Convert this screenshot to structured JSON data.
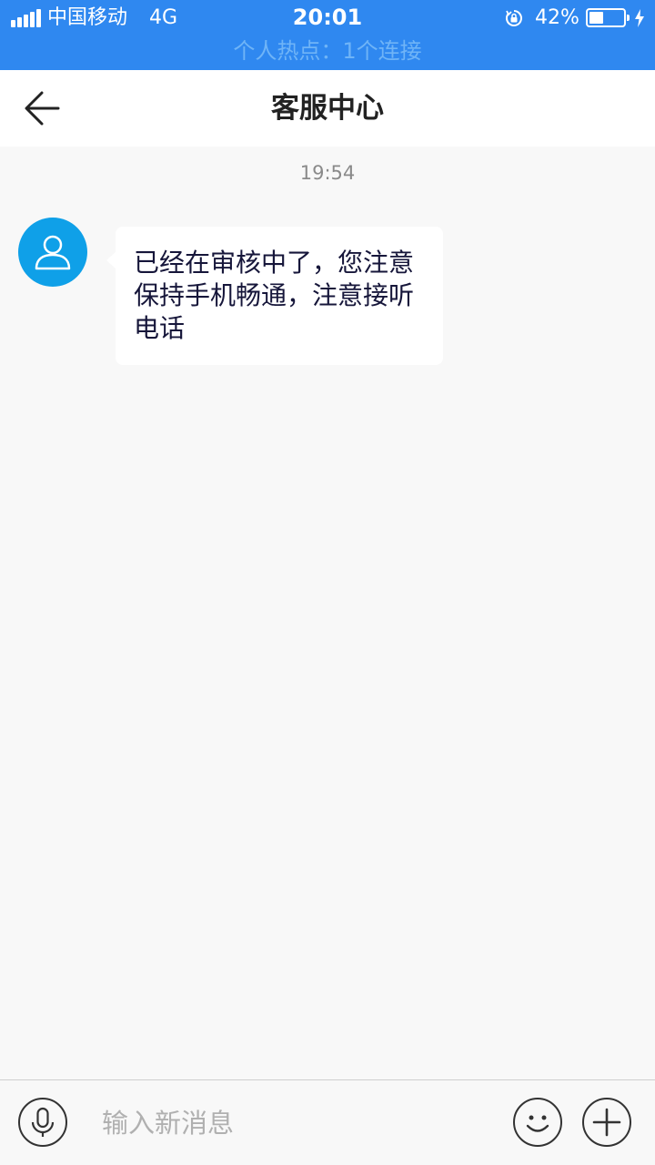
{
  "status_bar": {
    "carrier": "中国移动",
    "network": "4G",
    "time": "20:01",
    "battery_percent": "42%",
    "battery_level": 0.42,
    "hotspot": "个人热点：1个连接",
    "icons": [
      "signal-icon",
      "rotation-lock-icon",
      "battery-icon",
      "charging-bolt-icon"
    ],
    "background_color": "#2f88f0"
  },
  "header": {
    "title": "客服中心",
    "back_icon": "back-arrow-icon"
  },
  "chat": {
    "messages": [
      {
        "timestamp": "19:54",
        "sender_avatar_icon": "user-avatar-icon",
        "text": "已经在审核中了，您注意保持手机畅通，注意接听电话"
      }
    ],
    "avatar_color": "#0fa0e8"
  },
  "input_bar": {
    "placeholder": "输入新消息",
    "voice_icon": "microphone-icon",
    "emoji_icon": "emoji-icon",
    "plus_icon": "plus-icon"
  }
}
